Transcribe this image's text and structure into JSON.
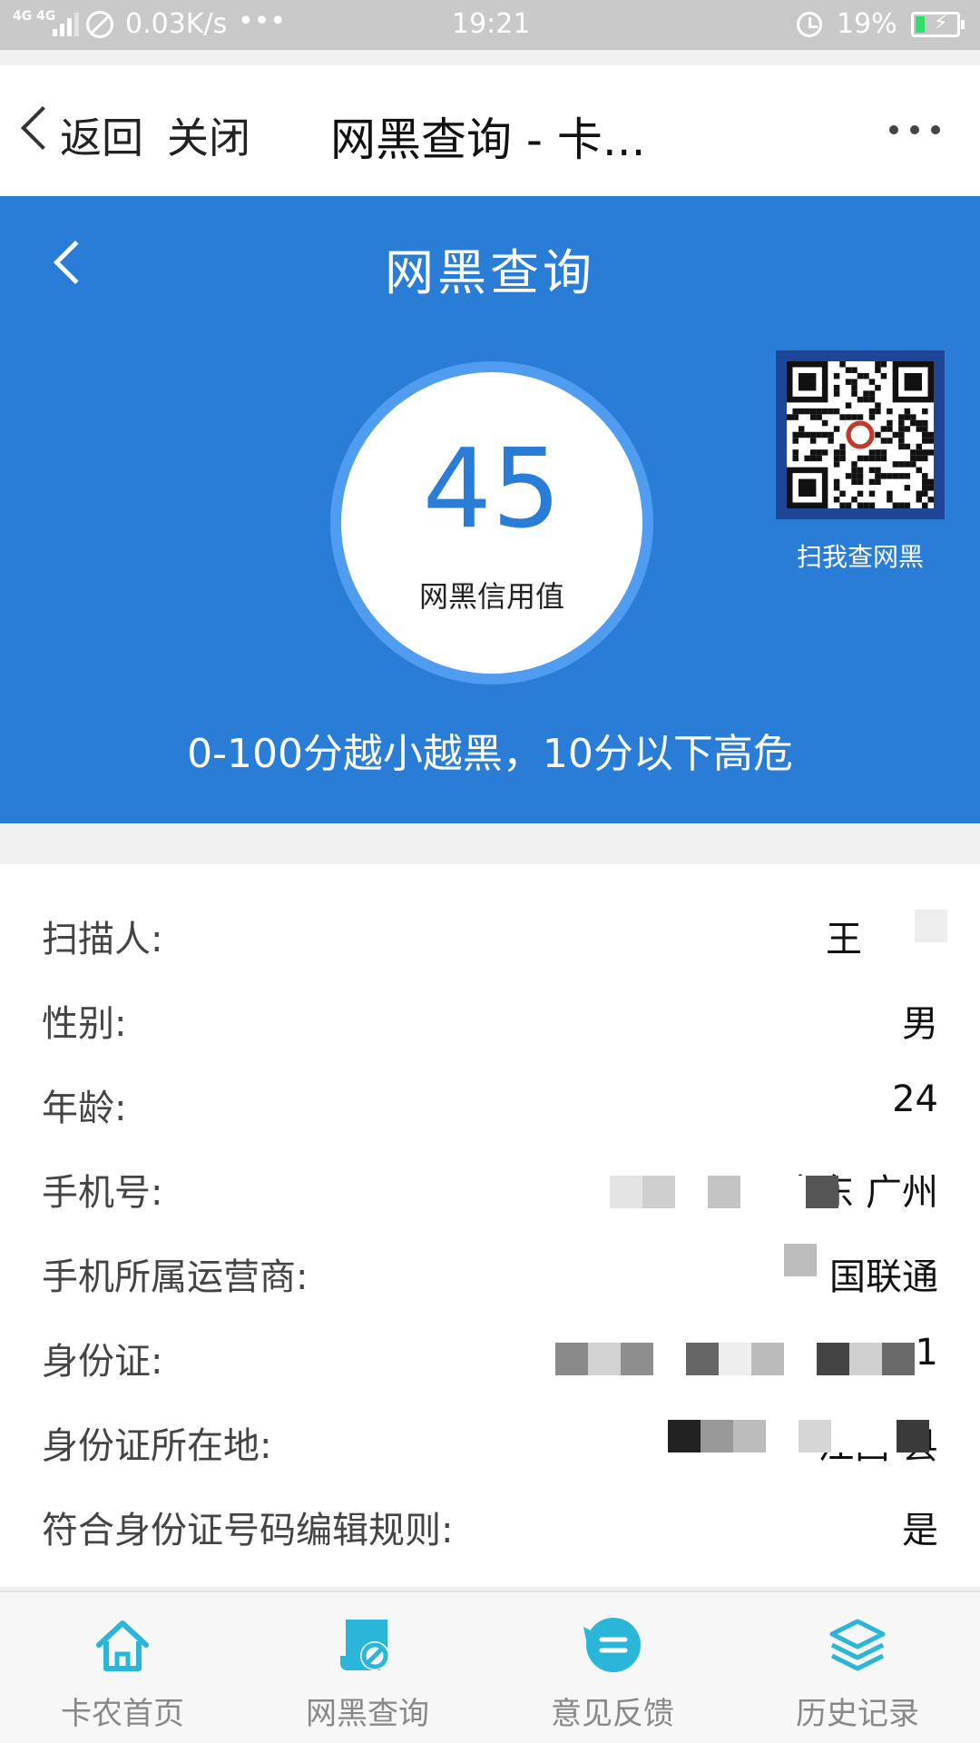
{
  "status_bar": {
    "network": "4G 4G",
    "speed": "0.03K/s",
    "more": "•••",
    "time": "19:21",
    "battery": "19%",
    "battery_color": "#2ee06a"
  },
  "browser": {
    "back_label": "返回",
    "close_label": "关闭",
    "page_title": "网黑查询 - 卡...",
    "more_icon": "more-dots-icon"
  },
  "hero": {
    "title": "网黑查询",
    "score": "45",
    "score_label": "网黑信用值",
    "qr_caption": "扫我查网黑",
    "hint": "0-100分越小越黑，10分以下高危",
    "bg_color": "#2a7dd6"
  },
  "info": {
    "rows": [
      {
        "label": "扫描人:",
        "value": "王"
      },
      {
        "label": "性别:",
        "value": "男"
      },
      {
        "label": "年龄:",
        "value": "24"
      },
      {
        "label": "手机号:",
        "value": "13128        广东 广州"
      },
      {
        "label": "手机所属运营商:",
        "value": "国联通"
      },
      {
        "label": "身份证:",
        "value": "1"
      },
      {
        "label": "身份证所在地:",
        "value": "江西              县"
      },
      {
        "label": "符合身份证号码编辑规则:",
        "value": "是"
      }
    ]
  },
  "tabs": [
    {
      "label": "卡农首页",
      "icon": "home-icon"
    },
    {
      "label": "网黑查询",
      "icon": "blacklist-query-icon"
    },
    {
      "label": "意见反馈",
      "icon": "feedback-icon"
    },
    {
      "label": "历史记录",
      "icon": "history-layers-icon"
    }
  ],
  "accent_color": "#29b6d8"
}
